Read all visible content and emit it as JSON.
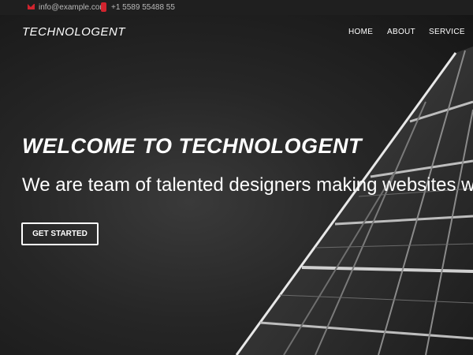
{
  "topbar": {
    "email": "info@example.com",
    "phone": "+1 5589 55488 55"
  },
  "nav": {
    "brand": "TECHNOLOGENT",
    "items": [
      {
        "label": "HOME"
      },
      {
        "label": "ABOUT"
      },
      {
        "label": "SERVICE"
      }
    ]
  },
  "hero": {
    "title": "WELCOME TO TECHNOLOGENT",
    "subtitle": "We are team of talented designers making websites with Bootstrap",
    "cta_label": "GET STARTED"
  },
  "icons": {
    "email": "envelope-icon",
    "phone": "phone-icon"
  },
  "colors": {
    "accent": "#d1242e",
    "topbar_bg": "#1f1f1f",
    "hero_bg": "#262626",
    "text": "#ffffff"
  }
}
